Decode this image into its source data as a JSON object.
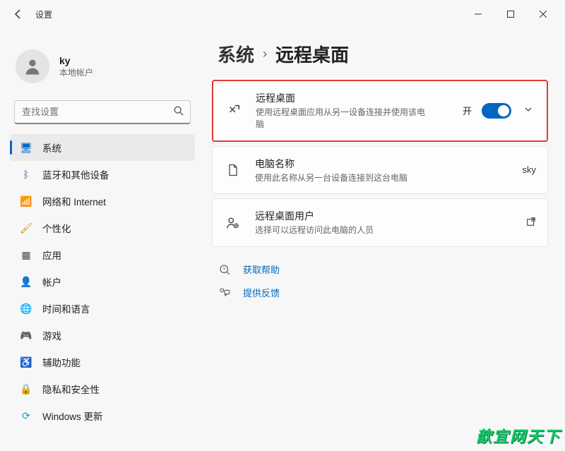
{
  "window": {
    "title": "设置"
  },
  "user": {
    "name": "ky",
    "subtitle": "本地帐户"
  },
  "search": {
    "placeholder": "查找设置"
  },
  "sidebar": {
    "items": [
      {
        "label": "系统",
        "icon": "🖥",
        "color": "#0067c0",
        "selected": true
      },
      {
        "label": "蓝牙和其他设备",
        "icon": "ᛒ",
        "color": "#0067c0"
      },
      {
        "label": "网络和 Internet",
        "icon": "📶",
        "color": "#0aa3d6"
      },
      {
        "label": "个性化",
        "icon": "🖌",
        "color": "#d08a2a"
      },
      {
        "label": "应用",
        "icon": "▦",
        "color": "#444"
      },
      {
        "label": "帐户",
        "icon": "👤",
        "color": "#555"
      },
      {
        "label": "时间和语言",
        "icon": "🌐",
        "color": "#1a9ed6"
      },
      {
        "label": "游戏",
        "icon": "🎮",
        "color": "#777"
      },
      {
        "label": "辅助功能",
        "icon": "♿",
        "color": "#2a6fd6"
      },
      {
        "label": "隐私和安全性",
        "icon": "🔒",
        "color": "#555"
      },
      {
        "label": "Windows 更新",
        "icon": "⟳",
        "color": "#0aa3d6"
      }
    ]
  },
  "breadcrumb": {
    "root": "系统",
    "leaf": "远程桌面",
    "sep": "›"
  },
  "cards": {
    "remote": {
      "title": "远程桌面",
      "desc": "使用远程桌面应用从另一设备连接并使用该电脑",
      "toggle_label": "开",
      "toggle_on": true
    },
    "pcname": {
      "title": "电脑名称",
      "desc": "使用此名称从另一台设备连接到这台电脑",
      "value": "sky"
    },
    "users": {
      "title": "远程桌面用户",
      "desc": "选择可以远程访问此电脑的人员"
    }
  },
  "links": {
    "help": "获取帮助",
    "feedback": "提供反馈"
  },
  "watermark": "歆宜网天下"
}
